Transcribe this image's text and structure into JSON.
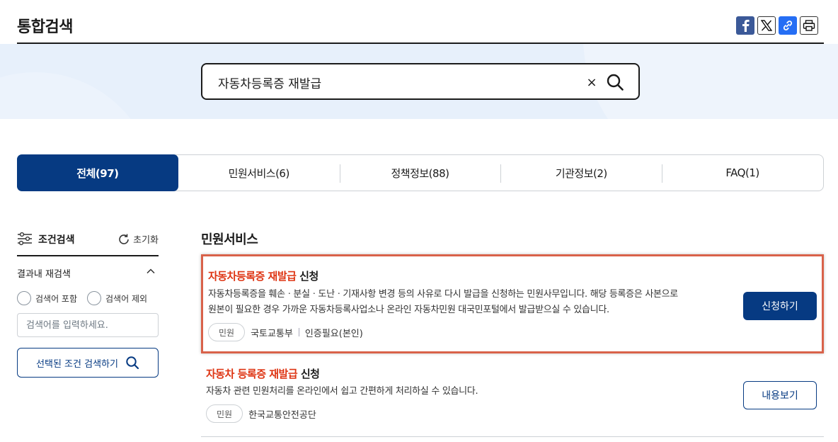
{
  "page": {
    "title": "통합검색"
  },
  "share": {
    "icons": [
      "facebook-icon",
      "x-icon",
      "link-icon",
      "print-icon"
    ]
  },
  "search": {
    "query": "자동차등록증 재발급",
    "clear_label": "×"
  },
  "tabs": [
    {
      "label": "전체(97)",
      "active": true
    },
    {
      "label": "민원서비스(6)",
      "active": false
    },
    {
      "label": "정책정보(88)",
      "active": false
    },
    {
      "label": "기관정보(2)",
      "active": false
    },
    {
      "label": "FAQ(1)",
      "active": false
    }
  ],
  "filter": {
    "title": "조건검색",
    "reset_label": "초기화",
    "refine_label": "결과내 재검색",
    "include_label": "검색어 포함",
    "exclude_label": "검색어 제외",
    "input_placeholder": "검색어를 입력하세요.",
    "search_button_label": "선택된 조건 검색하기"
  },
  "section": {
    "title": "민원서비스"
  },
  "results": [
    {
      "title_highlight": "자동차등록증 재발급",
      "title_rest": " 신청",
      "desc_line1": "자동차등록증을 훼손ㆍ분실ㆍ도난ㆍ기재사항 변경 등의 사유로 다시 발급을 신청하는 민원사무입니다. 해당 등록증은 사본으로",
      "desc_line2": "원본이 필요한 경우 가까운 자동차등록사업소나 온라인 자동차민원 대국민포털에서 발급받으실 수 있습니다.",
      "badge": "민원",
      "org": "국토교통부",
      "auth": "인증필요(본인)",
      "action_label": "신청하기"
    },
    {
      "title_highlight": "자동차 등록증 재발급",
      "title_rest": " 신청",
      "desc_line1": "자동차 관련 민원처리를 온라인에서 쉽고 간편하게 처리하실 수 있습니다.",
      "badge": "민원",
      "org": "한국교통안전공단",
      "action_label": "내용보기"
    }
  ],
  "colors": {
    "primary": "#063a82",
    "highlight": "#de3412",
    "band": "#e7f0fb",
    "selected_border": "#d9624a"
  }
}
